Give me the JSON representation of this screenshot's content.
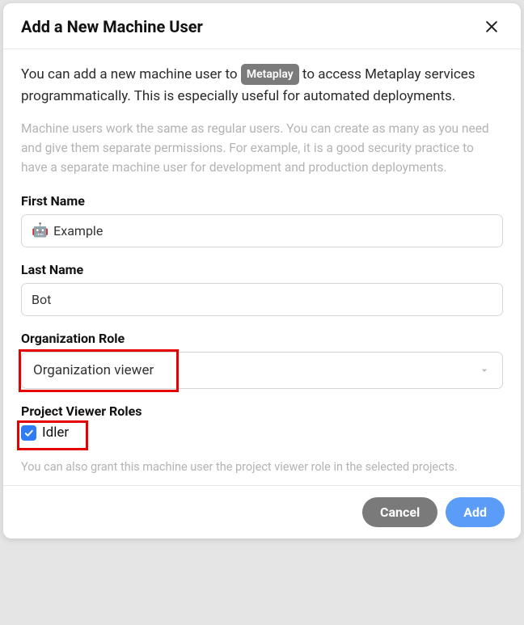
{
  "header": {
    "title": "Add a New Machine User"
  },
  "intro": {
    "prefix": "You can add a new machine user to ",
    "badge": "Metaplay",
    "suffix": " to access Metaplay services programmatically. This is especially useful for automated deployments."
  },
  "subtext": "Machine users work the same as regular users. You can create as many as you need and give them separate permissions. For example, it is a good security practice to have a separate machine user for development and production deployments.",
  "fields": {
    "first_name": {
      "label": "First Name",
      "value": "Example",
      "emoji": "🤖"
    },
    "last_name": {
      "label": "Last Name",
      "value": "Bot"
    },
    "org_role": {
      "label": "Organization Role",
      "value": "Organization viewer"
    },
    "project_roles": {
      "label": "Project Viewer Roles",
      "option_label": "Idler",
      "checked": true
    }
  },
  "helper": "You can also grant this machine user the project viewer role in the selected projects.",
  "footer": {
    "cancel": "Cancel",
    "add": "Add"
  }
}
